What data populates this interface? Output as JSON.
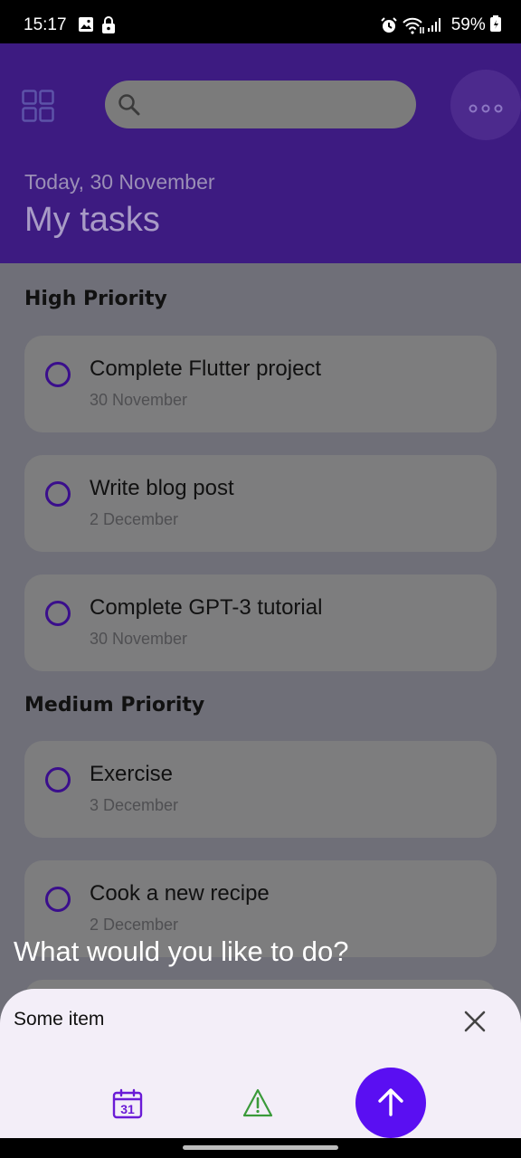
{
  "status_bar": {
    "time": "15:17",
    "battery": "59%"
  },
  "header": {
    "date": "Today, 30 November",
    "title": "My tasks"
  },
  "sections": [
    {
      "title": "High Priority",
      "tasks": [
        {
          "name": "Complete Flutter project",
          "date": "30 November"
        },
        {
          "name": "Write blog post",
          "date": "2 December"
        },
        {
          "name": "Complete GPT-3 tutorial",
          "date": "30 November"
        }
      ]
    },
    {
      "title": "Medium Priority",
      "tasks": [
        {
          "name": "Exercise",
          "date": "3 December"
        },
        {
          "name": "Cook a new recipe",
          "date": "2 December"
        }
      ]
    }
  ],
  "sheet": {
    "prompt": "What would you like to do?",
    "input_value": "Some item",
    "calendar_day": "31"
  },
  "colors": {
    "header_bg": "#3d1b81",
    "accent": "#5a0ff2",
    "warning_icon": "#3a9a3a"
  }
}
